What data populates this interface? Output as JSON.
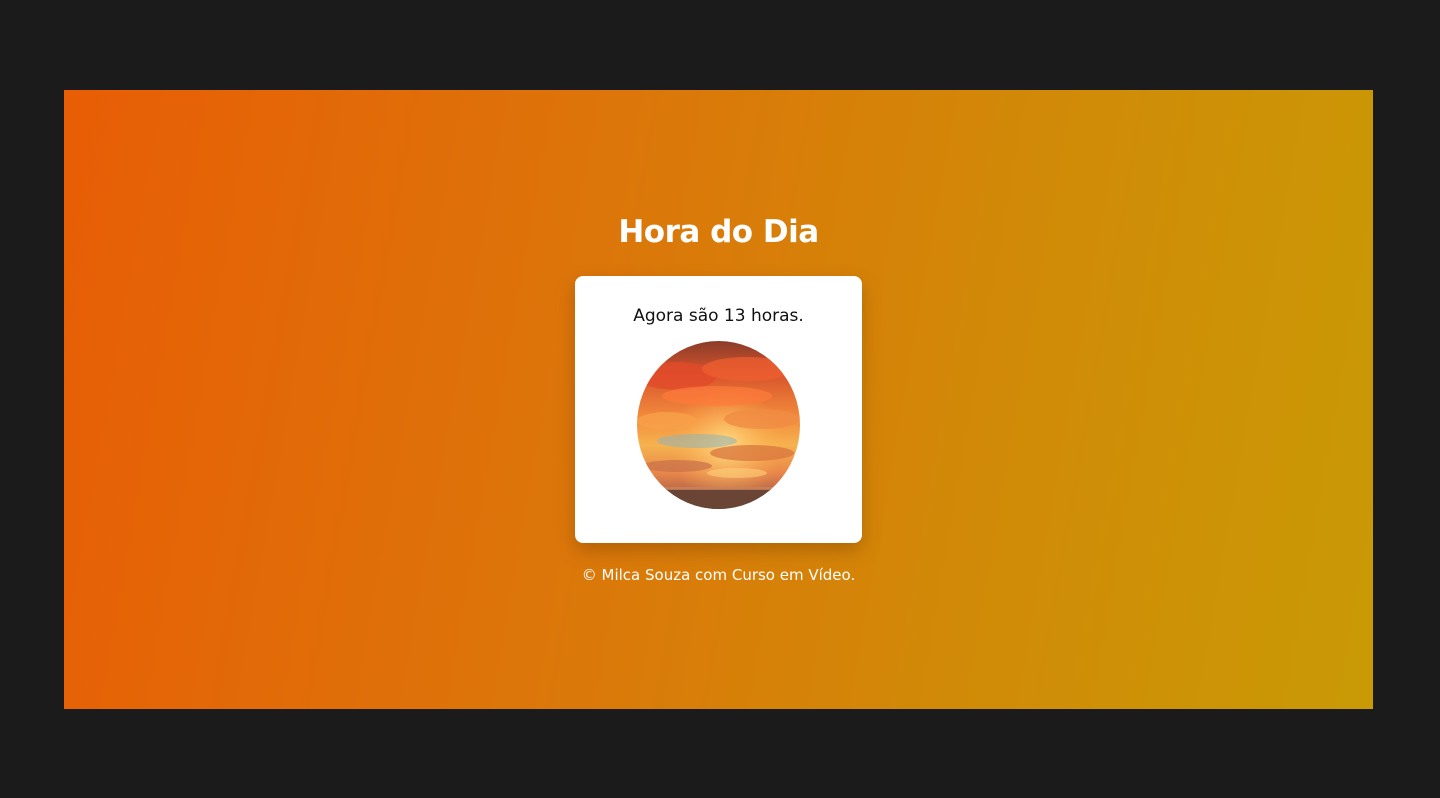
{
  "page": {
    "title": "Hora do Dia",
    "message": "Agora são 13 horas.",
    "image_alt": "sunset-sky",
    "footer": "© Milca Souza com Curso em Vídeo."
  },
  "colors": {
    "background": "#1b1b1b",
    "gradient_start": "#e85d05",
    "gradient_end": "#c99a06",
    "card": "#ffffff",
    "text_dark": "#111111",
    "text_light": "#ffffff"
  }
}
